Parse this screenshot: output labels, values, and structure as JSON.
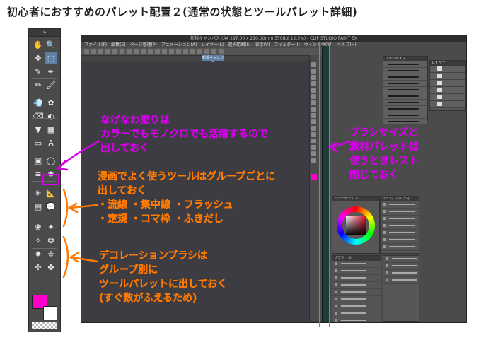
{
  "page": {
    "title": "初心者におすすめのパレット配置２(通常の状態とツールパレット詳細)"
  },
  "colors": {
    "annotation_pink": "#d400e8",
    "annotation_orange": "#ff7a00",
    "main_color": "#ff00cc",
    "sub_color": "#ffffff",
    "strip_highlight": "#d04ee0"
  },
  "app": {
    "title": "新規キャンバス (A4 297.00 x 210.00mm 350dpi 12.5%) - CLIP STUDIO PAINT EX",
    "menus": [
      "ファイル(F)",
      "編集(E)",
      "ページ管理(P)",
      "アニメーション(A)",
      "レイヤー(L)",
      "選択範囲(S)",
      "表示(V)",
      "フィルター(I)",
      "ウィンドウ(W)",
      "ヘルプ(H)"
    ],
    "canvas_tab": "新規キャンバス",
    "panels": {
      "brush_size": "ブラシサイズ",
      "layer": "レイヤー",
      "color_wheel": "カラーサークル",
      "sub_tool": "サブツール",
      "tool_property": "ツールプロパティ"
    }
  },
  "tool_palette": {
    "header": "»",
    "tools": [
      "move-hand-icon",
      "zoom-icon",
      "move-layer-icon",
      "selection-icon",
      "eyedropper-icon",
      "pen-icon",
      "pencil-icon",
      "brush-icon",
      "airbrush-icon",
      "decoration-icon",
      "eraser-icon",
      "blend-icon",
      "fill-icon",
      "gradient-icon",
      "figure-icon",
      "text-icon",
      "frame-icon",
      "balloon-icon",
      "speed-line-icon",
      "focus-line-icon",
      "flash-icon",
      "ruler-icon",
      "frame-border-icon",
      "balloon-tail-icon",
      "decoration-brush-1-icon",
      "decoration-brush-2-icon",
      "decoration-brush-3-icon",
      "decoration-brush-4-icon",
      "decoration-brush-5-icon",
      "decoration-brush-6-icon",
      "decoration-brush-7-icon",
      "decoration-brush-8-icon"
    ]
  },
  "annotations": {
    "note1": {
      "lines": [
        "なげなわ塗りは",
        "カラーでもモノクロでも活躍するので",
        "出しておく"
      ]
    },
    "note2": {
      "lines": [
        "漫画でよく使うツールはグループごとに",
        "出しておく",
        "・流線 ・集中線 ・フラッシュ",
        "・定規 ・コマ枠 ・ふきだし"
      ]
    },
    "note3": {
      "lines": [
        "デコレーションブラシは",
        "グループ別に",
        "ツールパレットに出しておく",
        "(すぐ数がふえるため)"
      ]
    },
    "note4": {
      "lines": [
        "ブラシサイズと",
        "素材パレットは",
        "使うときレスト",
        "閉じておく"
      ]
    }
  }
}
